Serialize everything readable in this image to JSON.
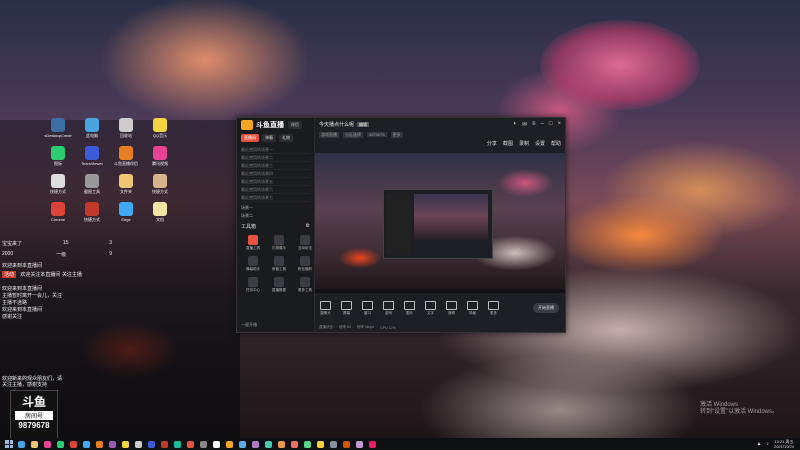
{
  "desktop": {
    "icons": [
      {
        "label": "sDesktopCmde",
        "icon": "chess-knight-icon",
        "color": "#3a6ea5"
      },
      {
        "label": "此电脑",
        "icon": "computer-icon",
        "color": "#4aa3df"
      },
      {
        "label": "回收站",
        "icon": "recycle-bin-icon",
        "color": "#cccccc"
      },
      {
        "label": "QQ音乐",
        "icon": "qq-music-icon",
        "color": "#f5d442"
      },
      {
        "label": "图标",
        "icon": "app-green-icon",
        "color": "#2ecc71"
      },
      {
        "label": "TeamViewer",
        "icon": "app-blue-icon",
        "color": "#3b5bdb"
      },
      {
        "label": "斗鱼直播伴侣",
        "icon": "app-orange-icon",
        "color": "#e67e22"
      },
      {
        "label": "腾讯视频",
        "icon": "app-pink-icon",
        "color": "#e84393"
      },
      {
        "label": "快捷方式",
        "icon": "app-white-icon",
        "color": "#dddddd"
      },
      {
        "label": "截图工具",
        "icon": "app-gray-icon",
        "color": "#999999"
      },
      {
        "label": "文件夹",
        "icon": "folder-icon",
        "color": "#f0c674"
      },
      {
        "label": "快捷方式",
        "icon": "app-tan-icon",
        "color": "#d9b38c"
      },
      {
        "label": "Chrome",
        "icon": "chrome-icon",
        "color": "#db4437"
      },
      {
        "label": "快捷方式",
        "icon": "app-red-icon",
        "color": "#c0392b"
      },
      {
        "label": "Edge",
        "icon": "edge-icon",
        "color": "#3fa9f5"
      },
      {
        "label": "文档",
        "icon": "document-icon",
        "color": "#f5e6a8"
      }
    ]
  },
  "side_panel": {
    "row1_left": "宝宝来了",
    "row1_mid": "15",
    "row1_right": "3",
    "row2_left": "2000",
    "row2_mid": "一级",
    "row2_right": "9",
    "line1": "欢迎来到本直播间",
    "badge": "活动",
    "line2": "欢迎关注本直播间",
    "line2_right": "关注主播",
    "block": [
      "欢迎来到本直播间",
      "主播暂时离开一会儿，关注",
      "主播不迷路",
      "欢迎来到本直播间",
      "感谢关注"
    ],
    "bottom": [
      "欢迎新来的观众朋友们，请",
      "关注主播，感谢支持"
    ]
  },
  "douyu": {
    "mark": "斗鱼",
    "room_label": "房间号",
    "room_number": "9879678"
  },
  "app": {
    "name": "斗鱼直播",
    "version_tag": "伴侣",
    "tabs": [
      "直播间",
      "弹幕",
      "礼物"
    ],
    "recent": [
      "最近使用的场景一",
      "最近使用的场景二",
      "最近使用的场景三",
      "最近使用的场景四",
      "最近使用的场景五",
      "最近使用的场景六",
      "最近使用的场景七"
    ],
    "scene_rows": [
      "场景一",
      "场景二"
    ],
    "toolbox_title": "工具箱",
    "tools": [
      "直播工具",
      "礼物展示",
      "互动玩法",
      "弹幕助手",
      "房管工具",
      "粉丝福利",
      "任务中心",
      "直播数据",
      "更多工具"
    ],
    "footer": "一键开播"
  },
  "main": {
    "live_title": "今天播点什么呢",
    "title_tag": "编辑",
    "sub_chips": [
      "游戏直播",
      "分区选择",
      "9879678",
      "更多"
    ],
    "actions": [
      "分享",
      "截图",
      "录制",
      "设置",
      "帮助"
    ],
    "controls": [
      "摄像头",
      "屏幕",
      "窗口",
      "游戏",
      "图片",
      "文字",
      "音频",
      "场景",
      "更多"
    ],
    "start_button": "开始直播",
    "status": [
      "直播状态",
      "帧率 60",
      "码率 0kbps",
      "CPU 12%"
    ]
  },
  "watermark": {
    "line1": "激活 Windows",
    "line2": "转到“设置”以激活 Windows。"
  },
  "taskbar": {
    "icons": [
      "#4aa3df",
      "#f0c674",
      "#e84393",
      "#2ecc71",
      "#db4437",
      "#3fa9f5",
      "#e67e22",
      "#9b59b6",
      "#f5d442",
      "#cccccc",
      "#3b5bdb",
      "#c0392b",
      "#1abc9c",
      "#e8523f",
      "#888888",
      "#ffffff",
      "#f5a623",
      "#5dade2",
      "#af7ac5",
      "#48c9b0",
      "#eb984e",
      "#ec7063",
      "#58d68d",
      "#f4d03f",
      "#85929e",
      "#d35400",
      "#c39bd3",
      "#e91e63"
    ],
    "time": "13:21 周五",
    "date": "2021/10/24"
  }
}
